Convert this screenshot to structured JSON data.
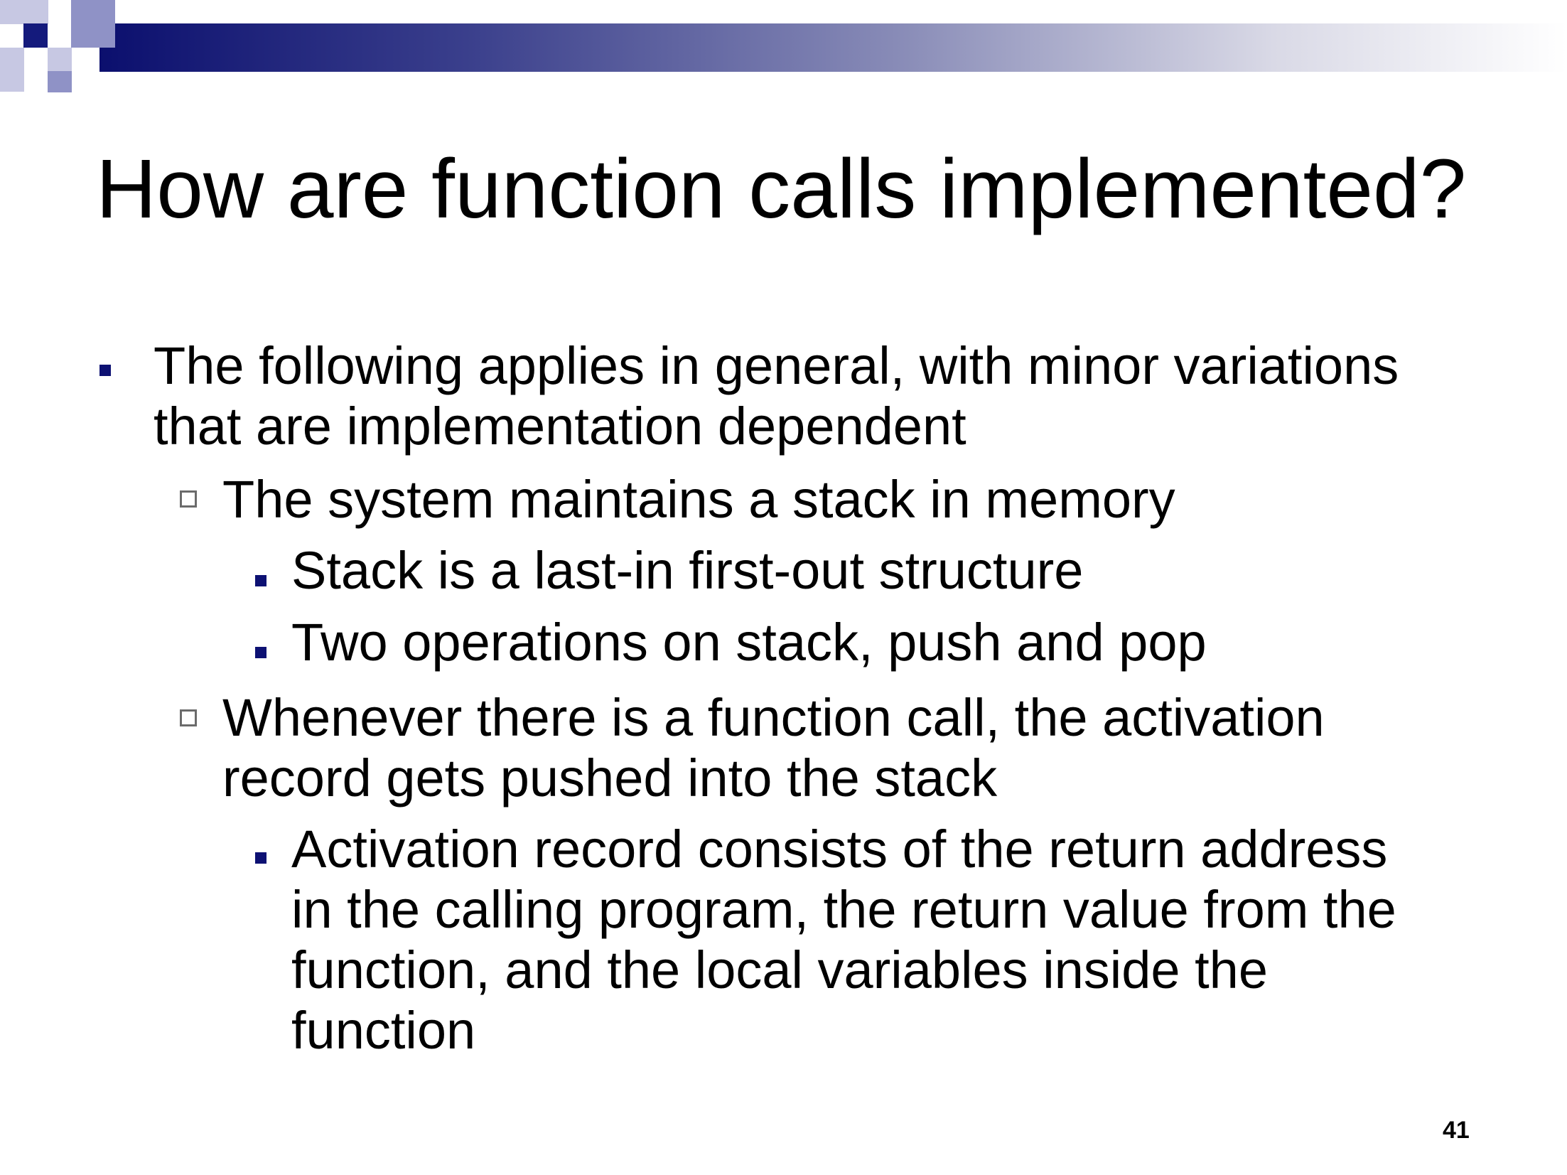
{
  "slide": {
    "title": "How are function calls implemented?",
    "bullets": [
      {
        "level": 1,
        "lines": [
          "The following applies in general, with minor variations",
          "that are implementation dependent"
        ]
      },
      {
        "level": 2,
        "lines": [
          "The system maintains a stack in memory"
        ]
      },
      {
        "level": 3,
        "lines": [
          "Stack is a last-in first-out structure"
        ]
      },
      {
        "level": 3,
        "lines": [
          "Two operations on stack, push and pop"
        ]
      },
      {
        "level": 2,
        "lines": [
          "Whenever there is a function call, the activation",
          "record gets pushed into the stack"
        ]
      },
      {
        "level": 3,
        "lines": [
          "Activation record consists of the return address",
          "in the calling program, the return value from the",
          "function, and the local variables inside the",
          "function"
        ]
      }
    ],
    "page_number": "41"
  },
  "colors": {
    "bullet_filled": "#0d1173",
    "bullet_hollow": "#6b6b6b",
    "header_dark": "#0b0f6e"
  }
}
